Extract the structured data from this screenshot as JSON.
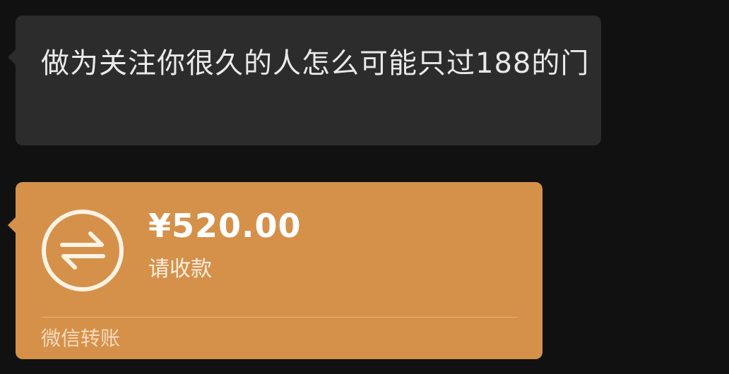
{
  "messages": {
    "text": "做为关注你很久的人怎么可能只过188的门"
  },
  "transfer": {
    "amount": "¥520.00",
    "status": "请收款",
    "label": "微信转账",
    "icon": "transfer-arrows-icon",
    "bg_color": "#d5914a"
  }
}
